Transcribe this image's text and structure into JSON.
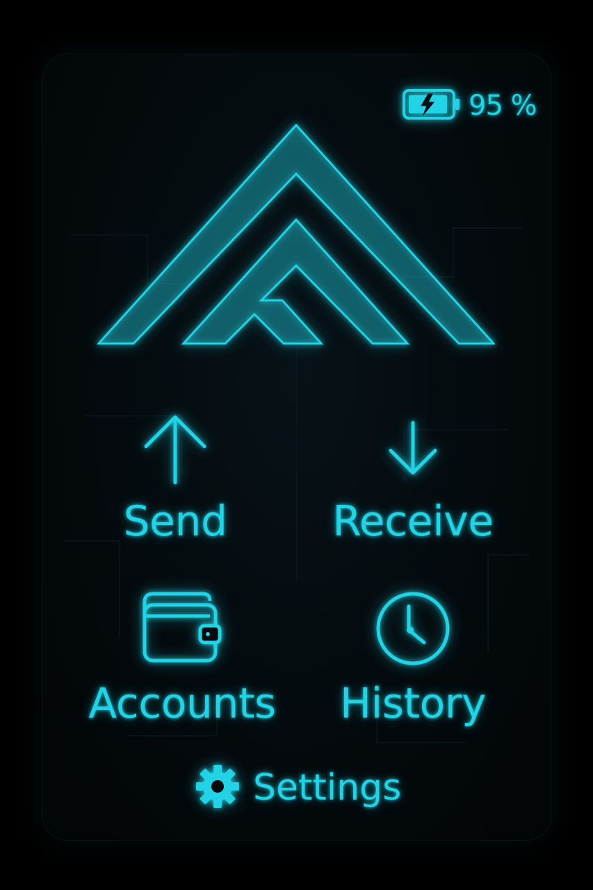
{
  "status": {
    "battery_level": 0.95,
    "battery_text": "95 %",
    "battery_icon": "battery-charging-icon"
  },
  "logo": {
    "icon": "chevron-mountain-logo"
  },
  "menu": {
    "send": {
      "label": "Send",
      "icon": "arrow-up-icon"
    },
    "receive": {
      "label": "Receive",
      "icon": "arrow-down-icon"
    },
    "accounts": {
      "label": "Accounts",
      "icon": "wallet-icon"
    },
    "history": {
      "label": "History",
      "icon": "clock-icon"
    },
    "settings": {
      "label": "Settings",
      "icon": "gear-icon"
    }
  },
  "colors": {
    "accent": "#22d3e6",
    "background": "#000000",
    "panel": "#040a0d"
  }
}
